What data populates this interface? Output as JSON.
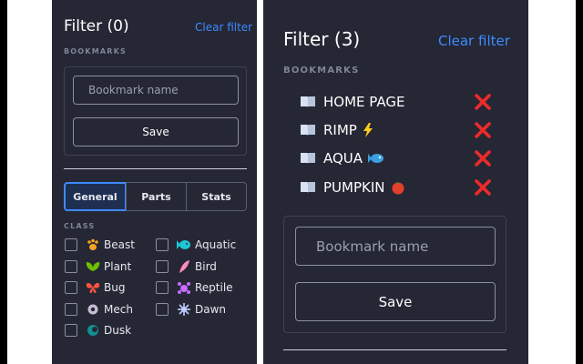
{
  "left_panel": {
    "title": "Filter (0)",
    "clear_label": "Clear filter",
    "section_bookmarks": "BOOKMARKS",
    "bookmark_placeholder": "Bookmark name",
    "save_label": "Save",
    "tabs": [
      {
        "label": "General",
        "active": true
      },
      {
        "label": "Parts",
        "active": false
      },
      {
        "label": "Stats",
        "active": false
      }
    ],
    "section_class": "CLASS",
    "classes": [
      {
        "label": "Beast",
        "icon": "paw-icon",
        "color": "#f5a623"
      },
      {
        "label": "Aquatic",
        "icon": "fish-icon",
        "color": "#1fc7d4"
      },
      {
        "label": "Plant",
        "icon": "leaf-icon",
        "color": "#6cc000"
      },
      {
        "label": "Bird",
        "icon": "feather-icon",
        "color": "#ff8bbd"
      },
      {
        "label": "Bug",
        "icon": "butterfly-icon",
        "color": "#ff5341"
      },
      {
        "label": "Reptile",
        "icon": "reptile-icon",
        "color": "#c56cfc"
      },
      {
        "label": "Mech",
        "icon": "gear-icon",
        "color": "#c6bdd4"
      },
      {
        "label": "Dawn",
        "icon": "sun-icon",
        "color": "#beceff"
      },
      {
        "label": "Dusk",
        "icon": "moon-icon",
        "color": "#129092"
      }
    ]
  },
  "right_panel": {
    "title": "Filter (3)",
    "clear_label": "Clear filter",
    "section_bookmarks": "BOOKMARKS",
    "bookmarks": [
      {
        "name": "HOME PAGE",
        "emoji": ""
      },
      {
        "name": "RIMP",
        "emoji": "lightning-icon"
      },
      {
        "name": "AQUA",
        "emoji": "fish-icon"
      },
      {
        "name": "PUMPKIN",
        "emoji": "tomato-icon"
      }
    ],
    "bookmark_placeholder": "Bookmark name",
    "save_label": "Save"
  },
  "colors": {
    "panel_bg": "#252735",
    "accent": "#3d8bff",
    "delete_red": "#ee2a2a"
  }
}
